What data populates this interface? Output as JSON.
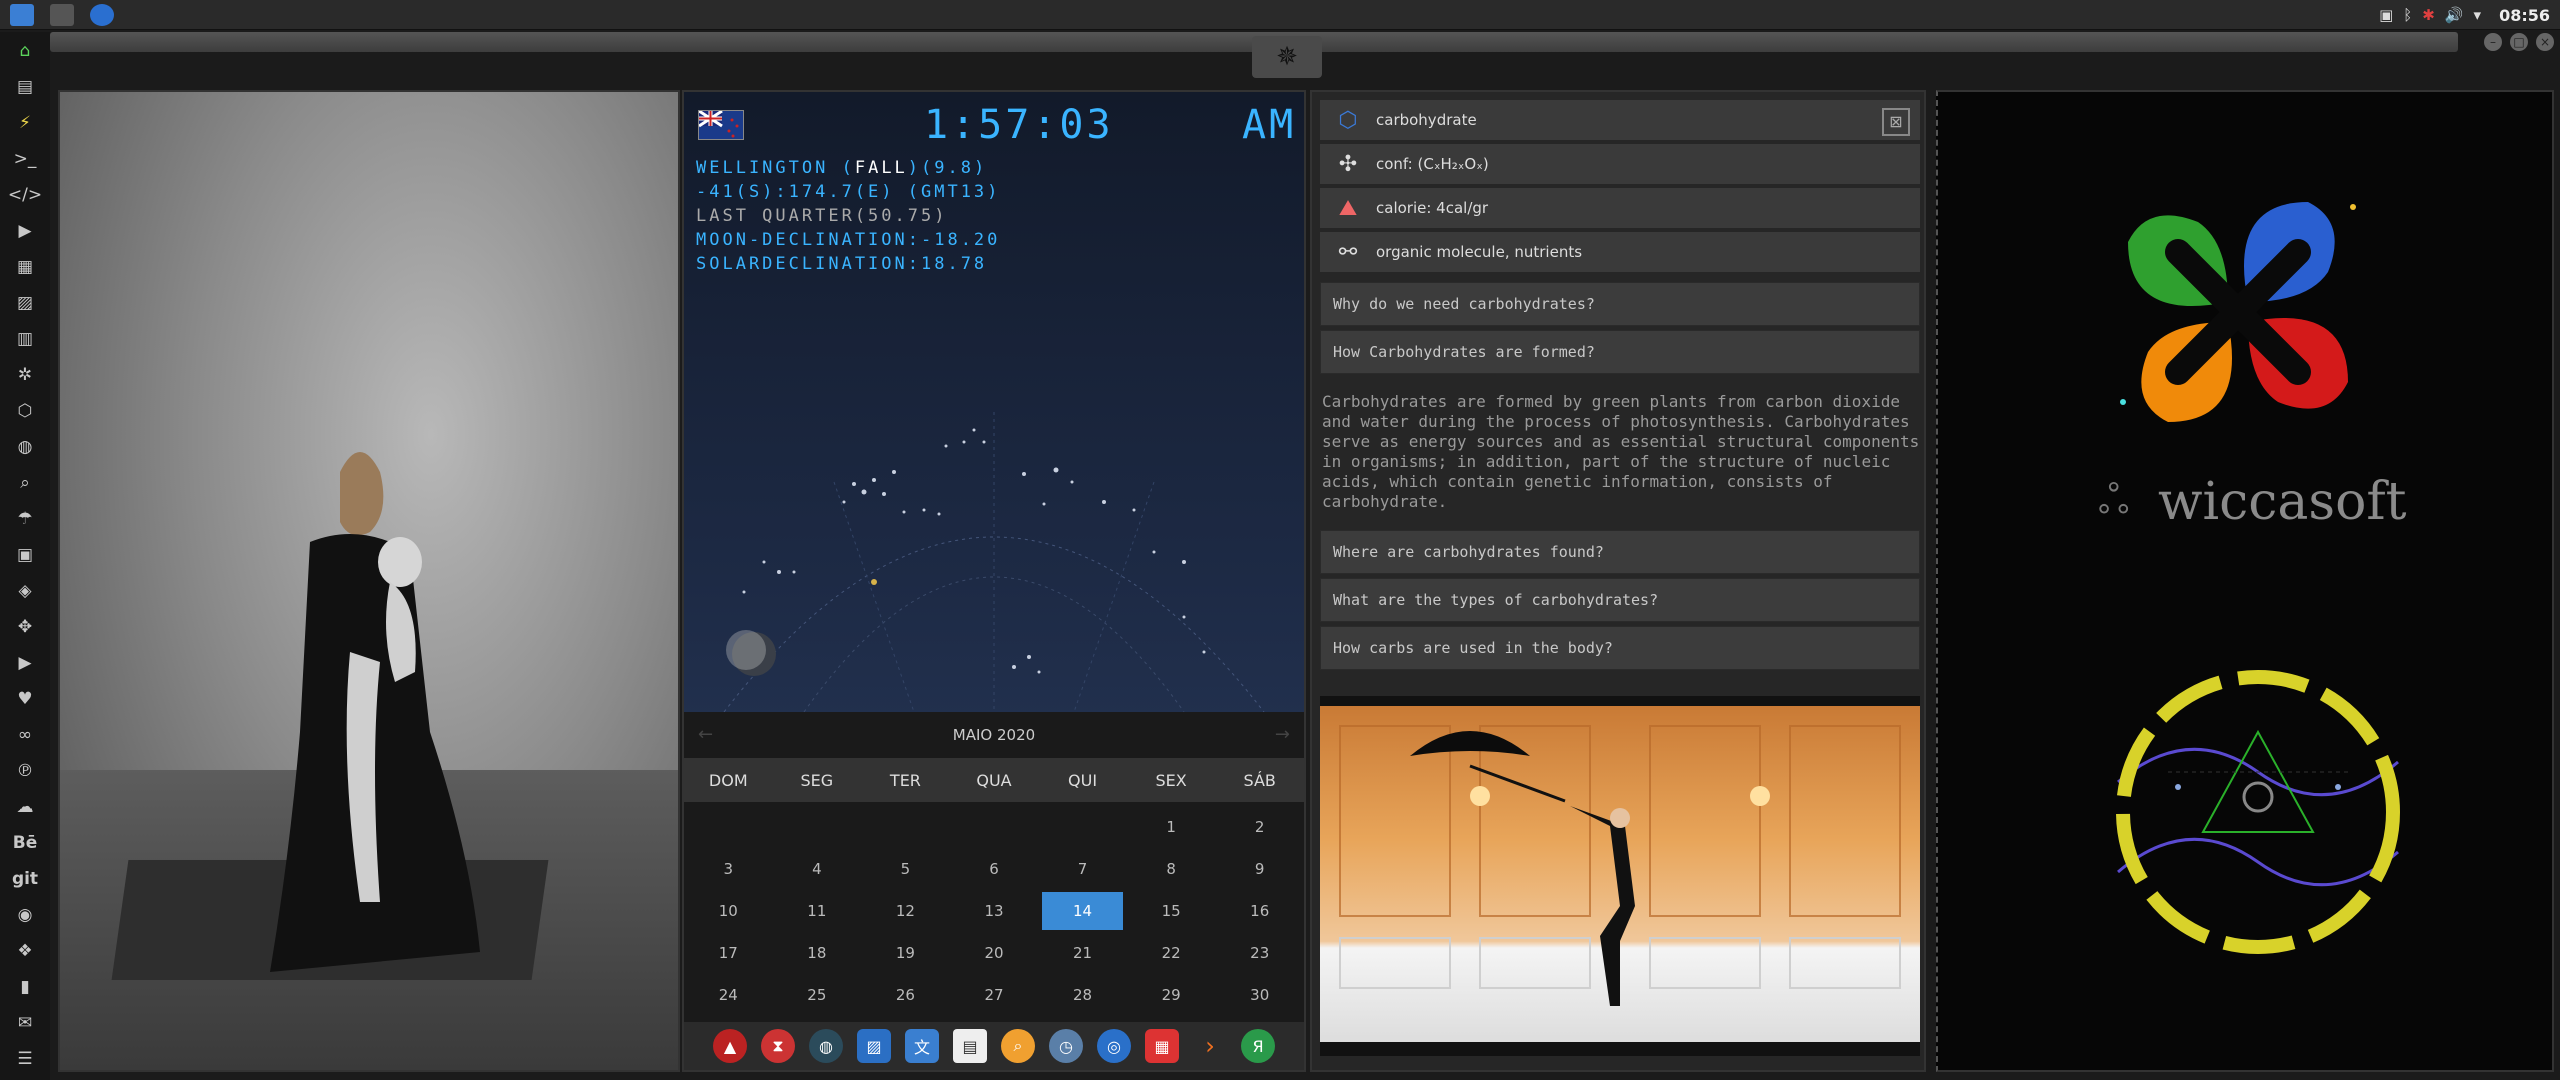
{
  "topbar": {
    "tray_icons": [
      "image-icon",
      "bluetooth-icon",
      "bug-icon",
      "volume-icon",
      "wifi-icon"
    ],
    "time": "08:56"
  },
  "sidebar": {
    "items": [
      "home-icon",
      "document-icon",
      "bolt-icon",
      "terminal-icon",
      "code-icon",
      "play-icon",
      "files-icon",
      "image-icon",
      "news-icon",
      "settings-icon",
      "hexagon-icon",
      "globe-icon",
      "search-icon",
      "umbrella-icon",
      "contact-icon",
      "layers-icon",
      "expand-icon",
      "youtube-icon",
      "heart-icon",
      "infinity-icon",
      "pinterest-icon",
      "cloud-icon",
      "behance-icon",
      "git-icon",
      "github-icon",
      "dropbox-icon",
      "map-icon",
      "mail-icon",
      "drawer-icon"
    ],
    "behance_label": "Bē",
    "git_label": "git"
  },
  "clock": {
    "time": "1:57:03",
    "ampm": "AM",
    "location": "WELLINGTON ",
    "season": "FALL",
    "season_tail": "(9.8)",
    "coords": "-41(S):174.7(E) (GMT13)",
    "moon_phase": "LAST QUARTER(50.75)",
    "moon_declination": "MOON-DECLINATION:-18.20",
    "solar_declination": "SOLARDECLINATION:18.78"
  },
  "calendar": {
    "month": "MAIO 2020",
    "dow": [
      "DOM",
      "SEG",
      "TER",
      "QUA",
      "QUI",
      "SEX",
      "SÁB"
    ],
    "days": [
      "",
      "",
      "",
      "",
      "",
      "1",
      "2",
      "3",
      "4",
      "5",
      "6",
      "7",
      "8",
      "9",
      "10",
      "11",
      "12",
      "13",
      "14",
      "15",
      "16",
      "17",
      "18",
      "19",
      "20",
      "21",
      "22",
      "23",
      "24",
      "25",
      "26",
      "27",
      "28",
      "29",
      "30"
    ],
    "selected": "14"
  },
  "info": {
    "title": "carbohydrate",
    "formula": "conf: (CₓH₂ₓOₓ)",
    "calorie": "calorie: 4cal/gr",
    "tags": "organic molecule, nutrients",
    "q1": "Why do we need carbohydrates?",
    "q2": "How Carbohydrates are formed?",
    "answer": "Carbohydrates are formed by green plants from carbon dioxide and water during the process of photosynthesis. Carbohydrates serve as energy sources and as essential structural components in organisms; in addition, part of the structure of nucleic acids, which contain genetic information, consists of carbohydrate.",
    "q3": "Where are carbohydrates found?",
    "q4": "What are the types of carbohydrates?",
    "q5": "How carbs are used in the body?"
  },
  "logo": {
    "name": "wiccasoft"
  },
  "colors": {
    "accent": "#3ab4ff",
    "calendar_selected": "#3a8bd6",
    "ring": "#d8d22a"
  }
}
